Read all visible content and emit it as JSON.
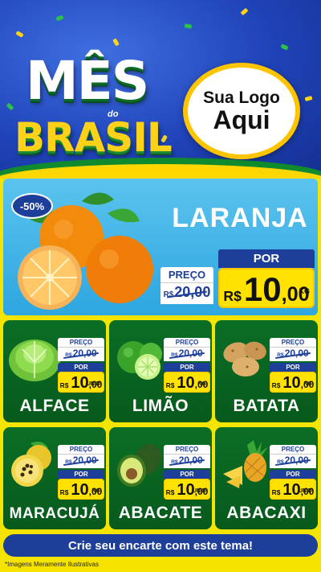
{
  "header": {
    "title_top": "MÊS",
    "title_mid": "do",
    "title_bottom": "BRASIL",
    "logo_line1": "Sua Logo",
    "logo_line2": "Aqui"
  },
  "featured": {
    "discount": "-50%",
    "name": "LARANJA",
    "old_label": "PREÇO",
    "old_currency": "R$",
    "old_price": "20,00",
    "new_label": "POR",
    "new_currency": "R$",
    "new_price_int": "10",
    "new_price_cents": ",00",
    "unit": "KG"
  },
  "products": [
    {
      "name": "ALFACE",
      "old_label": "PREÇO",
      "old_currency": "R$",
      "old_price": "20,00",
      "new_label": "POR",
      "new_currency": "R$",
      "new_price_int": "10",
      "new_price_cents": ",00",
      "unit": "UNID"
    },
    {
      "name": "LIMÃO",
      "old_label": "PREÇO",
      "old_currency": "R$",
      "old_price": "20,00",
      "new_label": "POR",
      "new_currency": "R$",
      "new_price_int": "10",
      "new_price_cents": ",00",
      "unit": "KG"
    },
    {
      "name": "BATATA",
      "old_label": "PREÇO",
      "old_currency": "R$",
      "old_price": "20,00",
      "new_label": "POR",
      "new_currency": "R$",
      "new_price_int": "10",
      "new_price_cents": ",00",
      "unit": "KG"
    },
    {
      "name": "MARACUJÁ",
      "old_label": "PREÇO",
      "old_currency": "R$",
      "old_price": "20,00",
      "new_label": "POR",
      "new_currency": "R$",
      "new_price_int": "10",
      "new_price_cents": ",00",
      "unit": "KG"
    },
    {
      "name": "ABACATE",
      "old_label": "PREÇO",
      "old_currency": "R$",
      "old_price": "20,00",
      "new_label": "POR",
      "new_currency": "R$",
      "new_price_int": "10",
      "new_price_cents": ",00",
      "unit": "UNID"
    },
    {
      "name": "ABACAXI",
      "old_label": "PREÇO",
      "old_currency": "R$",
      "old_price": "20,00",
      "new_label": "POR",
      "new_currency": "R$",
      "new_price_int": "10",
      "new_price_cents": ",00",
      "unit": "UNID"
    }
  ],
  "footer": {
    "banner": "Crie seu encarte com este tema!",
    "disclaimer": "*Imagens Meramente Ilustrativas"
  },
  "colors": {
    "header_blue": "#1f43b8",
    "brand_green": "#0b6e25",
    "brand_yellow": "#ffe200",
    "price_blue": "#1d3f9a",
    "featured_sky": "#2ea6e0"
  }
}
